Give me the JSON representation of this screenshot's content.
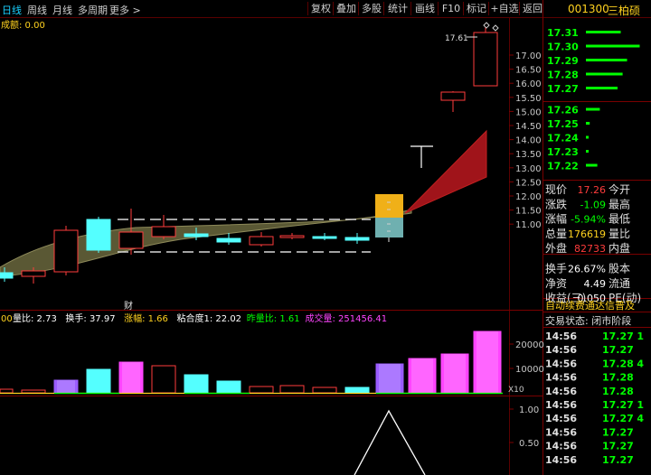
{
  "toolbar": {
    "tabs": [
      "日线",
      "周线",
      "月线",
      "多周期",
      "更多 >"
    ],
    "buttons": [
      "复权",
      "叠加",
      "多股",
      "统计",
      "画线",
      "F10",
      "标记",
      "+自选",
      "返回"
    ],
    "stock_code": "001300",
    "stock_name": "三柏硕"
  },
  "main_chart": {
    "overlay_label": "成额: 0.00",
    "high_label": "17.61",
    "price_axis": [
      "17.00",
      "16.50",
      "16.00",
      "15.50",
      "15.00",
      "14.50",
      "14.00",
      "13.50",
      "13.00",
      "12.50",
      "12.00",
      "11.50",
      "11.00"
    ],
    "cai_label": "财"
  },
  "indicator_line": {
    "v0": "00",
    "labels": [
      {
        "text": "量比: 2.73",
        "color": "#ffffff"
      },
      {
        "text": "换手: 37.97",
        "color": "#ffffff"
      },
      {
        "text": "涨幅: 1.66",
        "color": "#ffd21f"
      },
      {
        "text": "粘合度1: 22.02",
        "color": "#ffffff"
      },
      {
        "text": "昨量比: 1.61",
        "color": "#00ff00"
      },
      {
        "text": "成交量: 251456.41",
        "color": "#ff44ff"
      }
    ]
  },
  "volume_axis": [
    "20000",
    "10000"
  ],
  "volume_unit": "X10",
  "lower_axis": [
    "1.00",
    "0.50"
  ],
  "order_book": {
    "rows": [
      {
        "price": "17.31",
        "bar": 0.55
      },
      {
        "price": "17.30",
        "bar": 0.85
      },
      {
        "price": "17.29",
        "bar": 0.65
      },
      {
        "price": "17.28",
        "bar": 0.58
      },
      {
        "price": "17.27",
        "bar": 0.5
      },
      {
        "price": "17.26",
        "bar": 0.22
      },
      {
        "price": "17.25",
        "bar": 0.06
      },
      {
        "price": "17.24",
        "bar": 0.04
      },
      {
        "price": "17.23",
        "bar": 0.04
      },
      {
        "price": "17.22",
        "bar": 0.18
      }
    ]
  },
  "quote": {
    "rows": [
      {
        "label": "现价",
        "value": "17.26",
        "extra": "今开",
        "color": "#ff3c3c"
      },
      {
        "label": "涨跌",
        "value": "-1.09",
        "extra": "最高",
        "color": "#00ff00"
      },
      {
        "label": "涨幅",
        "value": "-5.94%",
        "extra": "最低",
        "color": "#00ff00"
      },
      {
        "label": "总量",
        "value": "176619",
        "extra": "量比",
        "color": "#ffd21f"
      },
      {
        "label": "外盘",
        "value": "82733",
        "extra": "内盘",
        "color": "#ff3c3c"
      },
      {
        "label": "换手",
        "value": "26.67%",
        "extra": "股本",
        "color": "#ffffff"
      },
      {
        "label": "净资",
        "value": "4.49",
        "extra": "流通",
        "color": "#ffffff"
      },
      {
        "label": "收益(三)",
        "value": "0.050",
        "extra": "PE(动)",
        "color": "#ffffff"
      }
    ]
  },
  "banner": "自动续费通达信普及",
  "trade_status": "交易状态: 闭市阶段",
  "ticks": [
    {
      "time": "14:56",
      "price": "17.27",
      "vol": "1",
      "color": "#00ff00"
    },
    {
      "time": "14:56",
      "price": "17.27",
      "vol": "",
      "color": "#00ff00"
    },
    {
      "time": "14:56",
      "price": "17.28",
      "vol": "4",
      "color": "#00ff00"
    },
    {
      "time": "14:56",
      "price": "17.28",
      "vol": "",
      "color": "#00ff00"
    },
    {
      "time": "14:56",
      "price": "17.28",
      "vol": "",
      "color": "#00ff00"
    },
    {
      "time": "14:56",
      "price": "17.27",
      "vol": "1",
      "color": "#00ff00"
    },
    {
      "time": "14:56",
      "price": "17.27",
      "vol": "4",
      "color": "#00ff00"
    },
    {
      "time": "14:56",
      "price": "17.27",
      "vol": "",
      "color": "#00ff00"
    },
    {
      "time": "14:56",
      "price": "17.27",
      "vol": "",
      "color": "#00ff00"
    },
    {
      "time": "14:56",
      "price": "17.27",
      "vol": "",
      "color": "#00ff00"
    }
  ],
  "colors": {
    "up": "#ff3c3c",
    "down": "#54ffff",
    "bg": "#000000",
    "grid": "#5a0000"
  }
}
